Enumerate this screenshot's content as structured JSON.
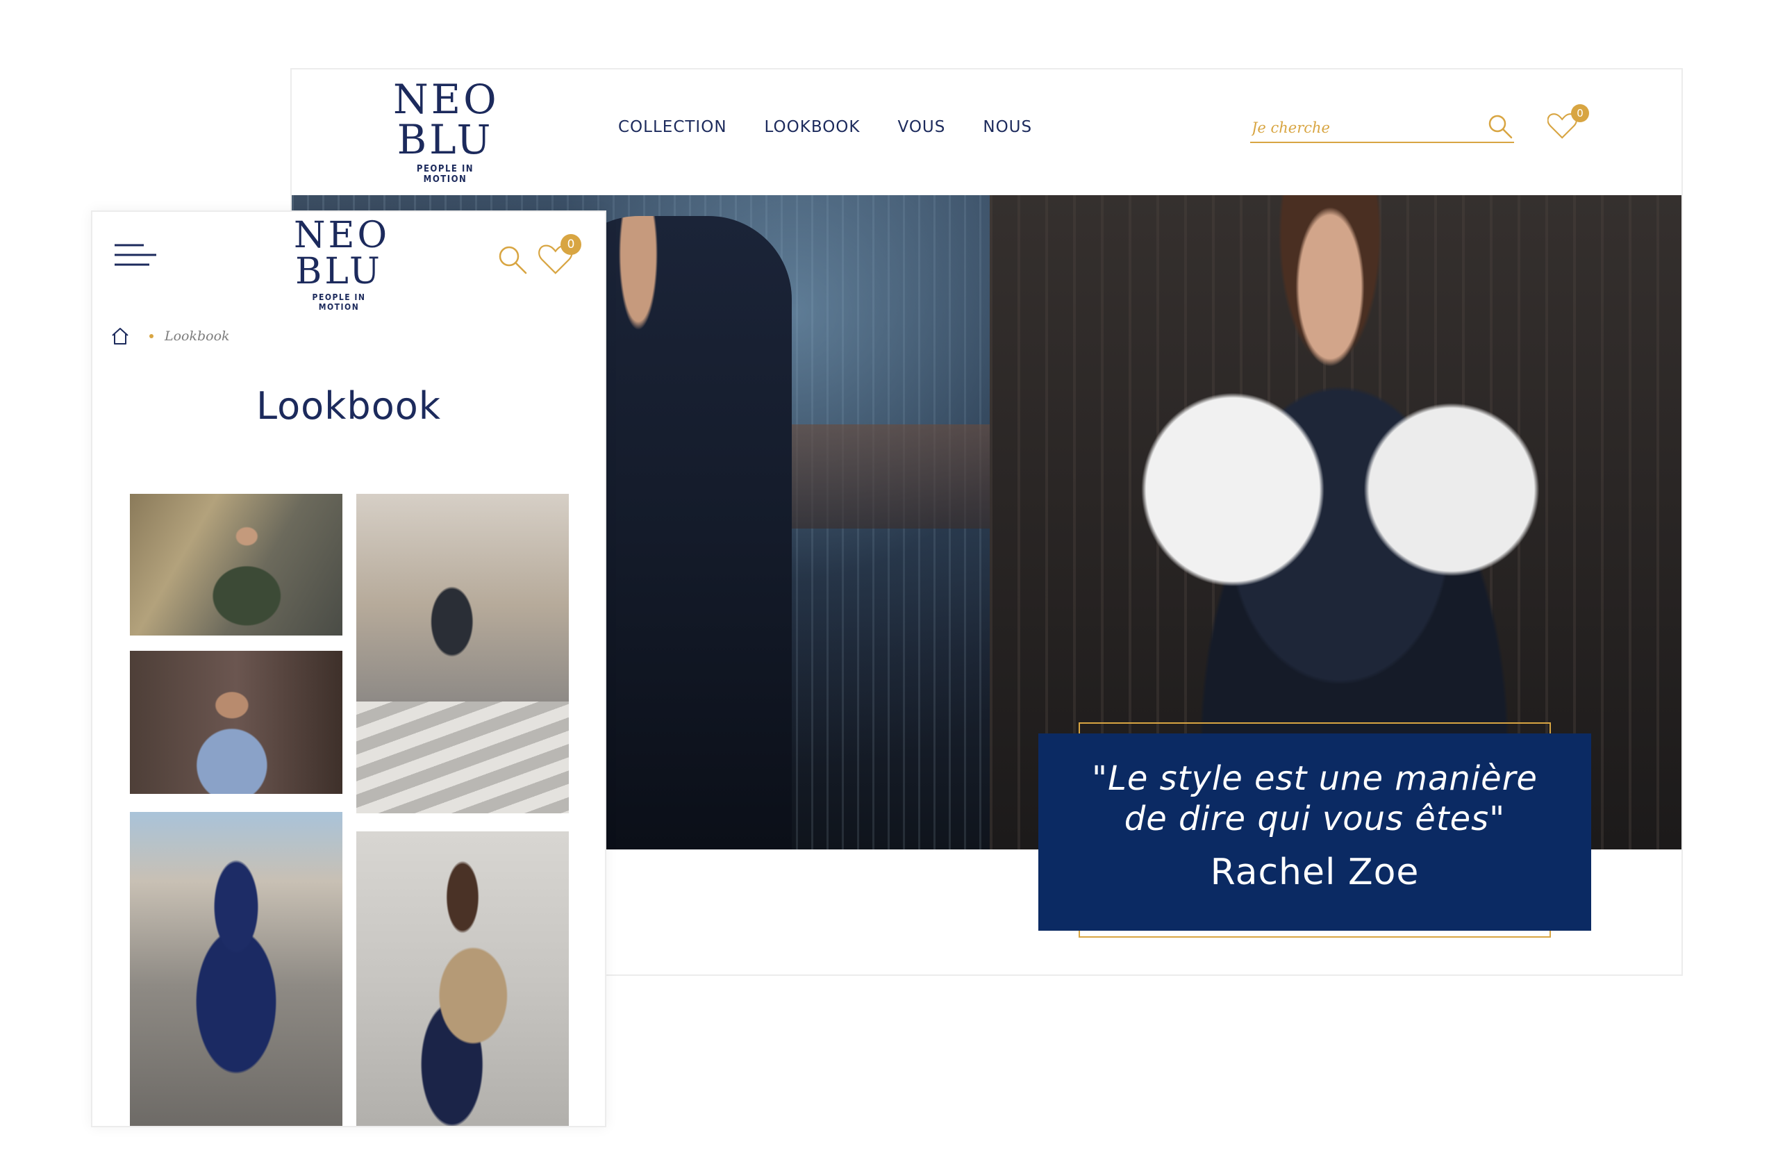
{
  "brand": {
    "logo_line1": "NEO",
    "logo_line2": "BLU",
    "tagline": "PEOPLE IN MOTION",
    "primary_color": "#1c2a5c",
    "accent_color": "#d8a542"
  },
  "desktop": {
    "nav": [
      {
        "label": "COLLECTION"
      },
      {
        "label": "LOOKBOOK"
      },
      {
        "label": "VOUS"
      },
      {
        "label": "NOUS"
      }
    ],
    "search": {
      "placeholder": "Je cherche",
      "icon": "search-icon"
    },
    "wishlist": {
      "count": "0",
      "icon": "heart-icon"
    },
    "hero": {
      "quote": "\"Le style est une manière de dire qui vous êtes\"",
      "author": "Rachel Zoe",
      "quote_bg": "#0b2a63"
    }
  },
  "mobile": {
    "menu_icon": "hamburger-icon",
    "search_icon": "search-icon",
    "wishlist": {
      "count": "0",
      "icon": "heart-icon"
    },
    "breadcrumb": {
      "home_icon": "home-icon",
      "current": "Lookbook"
    },
    "title": "Lookbook",
    "gallery_tiles": 5
  }
}
